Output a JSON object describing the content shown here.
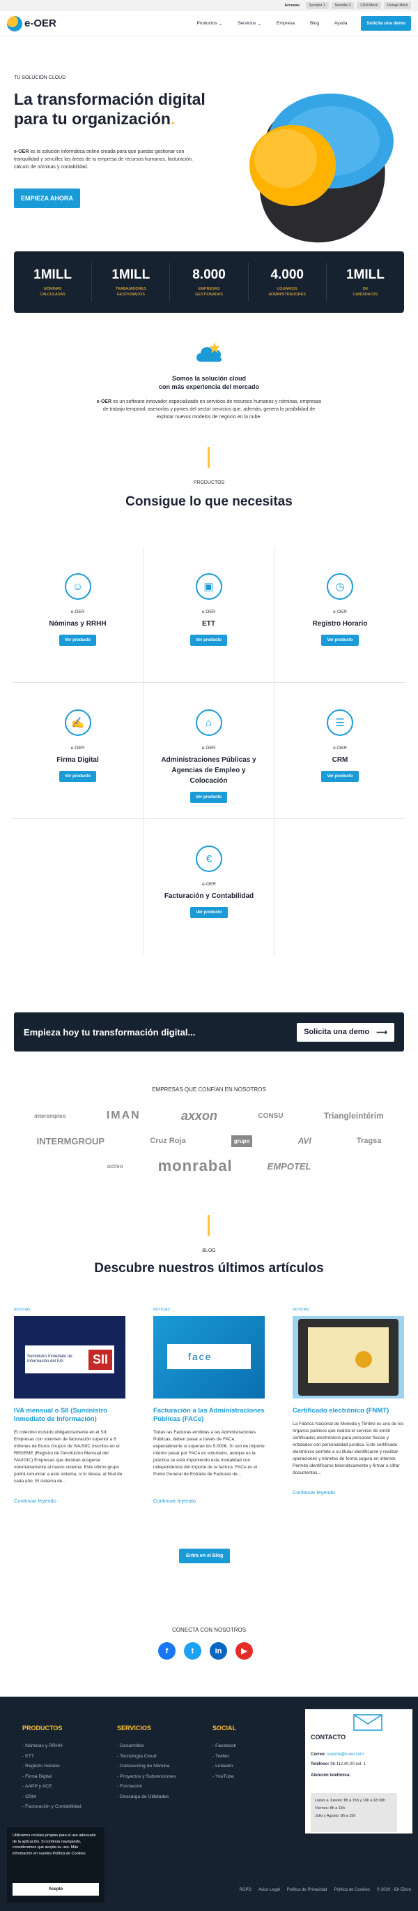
{
  "accessbar": {
    "title": "Accesos:",
    "items": [
      "Servidor 1",
      "Servidor 2",
      "CRM Móvil",
      "Fichaje Móvil"
    ]
  },
  "nav": {
    "logo": "e-OER",
    "items": [
      "Productos",
      "Servicios",
      "Empresa",
      "Blog",
      "Ayuda"
    ],
    "cta": "Solicita una demo"
  },
  "hero": {
    "kicker": "TU SOLUCIÓN CLOUD",
    "title": "La transformación digital para tu organización",
    "title_dot": ".",
    "brand": "e-OER",
    "desc": " es la solución informática online creada para que puedas gestionar con tranquilidad y sencillez las áreas de tu empresa de recursos humanos, facturación, cálculo de nóminas y contabilidad.",
    "cta": "EMPIEZA AHORA"
  },
  "stats": [
    {
      "num": "1MILL",
      "l1": "NÓMINAS",
      "l2": "CALCULADAS"
    },
    {
      "num": "1MILL",
      "l1": "TRABAJADORES",
      "l2": "GESTIONADOS"
    },
    {
      "num": "8.000",
      "l1": "EMPRESAS",
      "l2": "GESTIONADAS"
    },
    {
      "num": "4.000",
      "l1": "USUARIOS",
      "l2": "ADMINISTRADORES"
    },
    {
      "num": "1MILL",
      "l1": "DE",
      "l2": "CANDIDATOS"
    }
  ],
  "intro": {
    "t1": "Somos la solución cloud",
    "t2": "con más experiencia del mercado",
    "brand": "e-OER",
    "desc": " es un software innovador especializado en servicios de recursos humanos y nóminas, empresas de trabajo temporal, asesorías y pymes del sector servicios que, además, genera la posibilidad de explotar nuevos modelos de negocio en la nube."
  },
  "products": {
    "kicker": "PRODUCTOS",
    "title": "Consigue lo que necesitas",
    "sub": "e-OER",
    "button": "Ver producto",
    "items": [
      {
        "name": "Nóminas y RRHH",
        "icon": "person-icon"
      },
      {
        "name": "ETT",
        "icon": "briefcase-icon"
      },
      {
        "name": "Registro Horario",
        "icon": "clock-icon"
      },
      {
        "name": "Firma Digital",
        "icon": "signature-icon"
      },
      {
        "name": "Administraciones Públicas y Agencias de Empleo y Colocación",
        "icon": "building-icon"
      },
      {
        "name": "CRM",
        "icon": "id-card-icon"
      },
      {
        "name": "Facturación y Contabilidad",
        "icon": "invoice-icon"
      }
    ]
  },
  "banner": {
    "text": "Empieza hoy tu transformación digital...",
    "cta": "Solicita una demo"
  },
  "clients": {
    "title": "EMPRESAS QUE CONFÍAN EN NOSOTROS",
    "rows": [
      [
        "interempleo",
        "IMAN",
        "axxon",
        "CONSU",
        "Triangleintérim"
      ],
      [
        "INTERMGROUP",
        "Cruz Roja",
        "grupo",
        "AVI",
        "Tragsa"
      ],
      [
        "actívo",
        "monrabal",
        "EMPOTEL"
      ]
    ]
  },
  "blog": {
    "kicker": "BLOG",
    "title": "Descubre nuestros últimos artículos",
    "more": "Continuar leyendo",
    "cta": "Entra en el Blog",
    "posts": [
      {
        "cat": "NOTICIAS",
        "img_text": "Suministro Inmediato de Información del IVA",
        "img_badge": "SII",
        "title": "IVA mensual o SII (Suministro Inmediato de Información)",
        "excerpt": "El colectivo incluido obligatoriamente en el SII: Empresas con volumen de facturación superior a 6 millones de Euros Grupos de IVA/SIIC inscritos en el REDEME (Registro de Devolución Mensual del IVA/IGIC) Empresas que decidan acogerse voluntariamente al nuevo sistema. Este último grupo podrá renunciar a este sistema, si lo desea, al final de cada año. El sistema de..."
      },
      {
        "cat": "NOTICIAS",
        "img_text": "face",
        "title": "Facturación a las Administraciones Públicas (FACe)",
        "excerpt": "Todas las Facturas emitidas a las Administraciones Públicas, deben pasar a través de FACe, especialmente si superan los 5.000€. Si son de importe inferior pasar por FACe es voluntario, aunque es la práctica se está imponiendo esta modalidad con independencia del importe de la factura. FACe es el Punto General de Entrada de Facturas de..."
      },
      {
        "cat": "NOTICIAS",
        "title": "Certificado electrónico (FNMT)",
        "excerpt": "La Fábrica Nacional de Moneda y Timbre es uno de los órganos públicos que realiza el servicio de emitir certificados electrónicos para personas físicas y entidades con personalidad jurídica. Este certificado electrónico permite a su titular identificarse y realizar operaciones y trámites de forma segura en internet. Permite identificarse telemáticamente y firmar o cifrar documentos..."
      }
    ]
  },
  "connect": {
    "title": "CONECTA CON NOSOTROS"
  },
  "footer": {
    "cols": [
      {
        "title": "PRODUCTOS",
        "items": [
          "Nóminas y RRHH",
          "ETT",
          "Registro Horario",
          "Firma Digital",
          "AAPP y ACE",
          "CRM",
          "Facturación y Contabilidad"
        ]
      },
      {
        "title": "SERVICIOS",
        "items": [
          "Desarrollos",
          "Tecnología Cloud",
          "Outsourcing de Nómina",
          "Proyectos y Subvenciones",
          "Formación",
          "Descarga de Utilidades"
        ]
      },
      {
        "title": "SOCIAL",
        "items": [
          "Facebook",
          "Twitter",
          "Linkedin",
          "YouTube"
        ]
      }
    ],
    "contact": {
      "title": "CONTACTO",
      "mail_label": "Correo:",
      "mail": "soporte@e-oer.com",
      "phone_label": "Teléfono:",
      "phone": "96.112.40.00 ext. 1",
      "hours_title": "Atención telefónica:",
      "h1": "Lunes a Jueves: 8h a 15h y 16h a 18:30h",
      "h2": "Viernes: 8h a 15h",
      "h3": "Julio y Agosto: 8h a 15h"
    },
    "legal": [
      "RGPD",
      "Aviso Legal",
      "Política de Privacidad",
      "Política de Cookies",
      "© 2020 - IDI Eikon"
    ]
  },
  "cookie": {
    "text": "Utilizamos cookies propias para el uso adecuado de la aplicación. Si continúa navegando, consideramos que acepta su uso. Más información en nuestra Política de Cookies.",
    "accept": "Acepto"
  }
}
